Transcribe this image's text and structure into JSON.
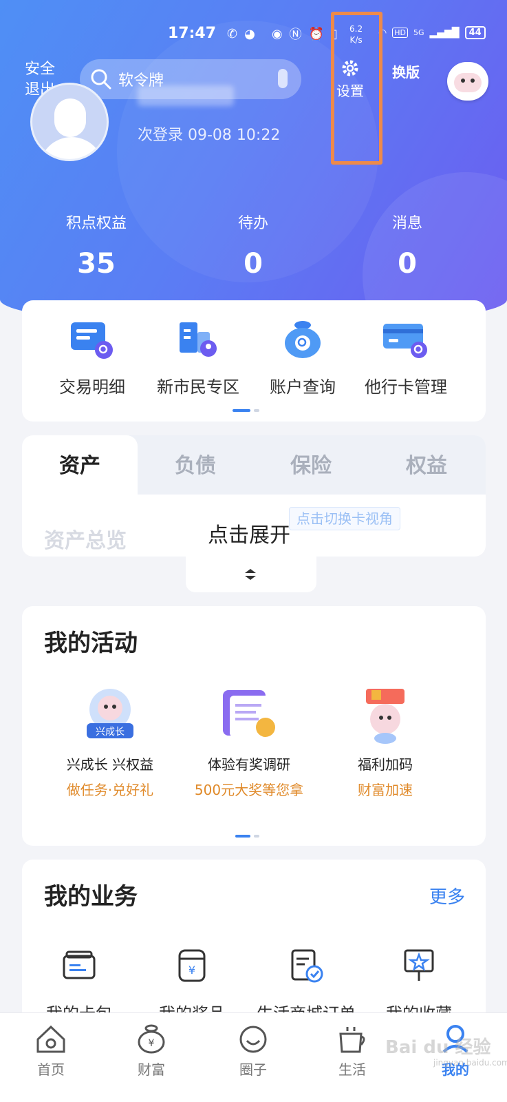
{
  "status_bar": {
    "time": "17:47",
    "speed_value": "6.2",
    "speed_unit": "K/s",
    "hd": "HD",
    "network": "5G",
    "battery": "44"
  },
  "header": {
    "logout_label": "安全退出",
    "search_placeholder": "软令牌",
    "settings_label": "设置",
    "switch_version_label": "换版",
    "last_login": "次登录 09-08 10:22"
  },
  "stats": [
    {
      "label": "积点权益",
      "value": "35"
    },
    {
      "label": "待办",
      "value": "0"
    },
    {
      "label": "消息",
      "value": "0"
    }
  ],
  "quick_actions": [
    {
      "label": "交易明细",
      "icon": "transaction-detail-icon"
    },
    {
      "label": "新市民专区",
      "icon": "new-citizen-icon"
    },
    {
      "label": "账户查询",
      "icon": "account-query-icon"
    },
    {
      "label": "他行卡管理",
      "icon": "other-bank-card-icon"
    }
  ],
  "asset_tabs": [
    "资产",
    "负债",
    "保险",
    "权益"
  ],
  "asset_panel": {
    "title": "资产总览",
    "expand_text": "点击展开",
    "switch_card_tag": "点击切换卡视角"
  },
  "activities": {
    "title": "我的活动",
    "items": [
      {
        "title": "兴成长 兴权益",
        "sub": "做任务·兑好礼",
        "badge": "兴成长"
      },
      {
        "title": "体验有奖调研",
        "sub": "500元大奖等您拿"
      },
      {
        "title": "福利加码",
        "sub": "财富加速"
      }
    ]
  },
  "business": {
    "title": "我的业务",
    "more": "更多",
    "items": [
      {
        "label": "我的卡包",
        "icon": "card-wallet-icon"
      },
      {
        "label": "我的奖品",
        "icon": "prize-icon"
      },
      {
        "label": "生活商城订单",
        "icon": "order-icon"
      },
      {
        "label": "我的收藏",
        "icon": "favorite-icon"
      }
    ]
  },
  "bottom_nav": [
    {
      "label": "首页",
      "icon": "home-icon"
    },
    {
      "label": "财富",
      "icon": "wealth-icon"
    },
    {
      "label": "圈子",
      "icon": "circle-icon"
    },
    {
      "label": "生活",
      "icon": "life-icon"
    },
    {
      "label": "我的",
      "icon": "mine-icon",
      "active": true
    }
  ],
  "watermark": {
    "main": "Bai du 经验",
    "sub": "jingyan.baidu.com"
  },
  "colors": {
    "header_start": "#4f8ff5",
    "header_end": "#6c5cf0",
    "accent": "#3a82f0",
    "highlight": "#ee8a4a",
    "activity_sub": "#e08a2a"
  }
}
